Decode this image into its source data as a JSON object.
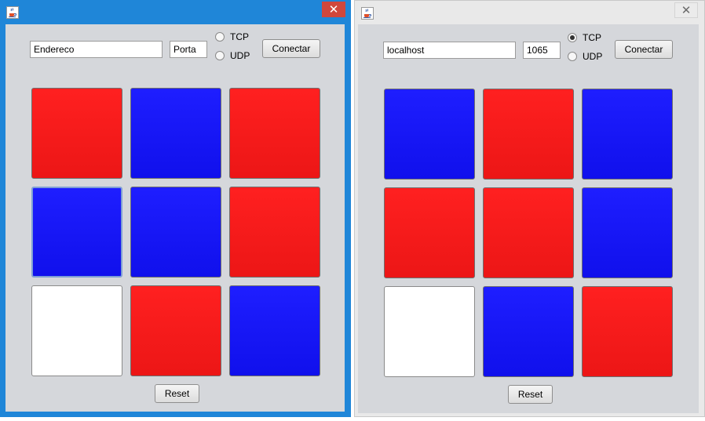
{
  "windows": [
    {
      "id": "left",
      "address_value": "Endereco",
      "port_value": "Porta",
      "protocols": [
        {
          "label": "TCP",
          "selected": false
        },
        {
          "label": "UDP",
          "selected": false
        }
      ],
      "connect_label": "Conectar",
      "reset_label": "Reset",
      "close_glyph": "✕",
      "cells": [
        "red",
        "blue",
        "red",
        "blue",
        "blue",
        "red",
        "white",
        "red",
        "blue"
      ],
      "focused_cell": 3
    },
    {
      "id": "right",
      "address_value": "localhost",
      "port_value": "1065",
      "protocols": [
        {
          "label": "TCP",
          "selected": true
        },
        {
          "label": "UDP",
          "selected": false
        }
      ],
      "connect_label": "Conectar",
      "reset_label": "Reset",
      "close_glyph": "✕",
      "cells": [
        "blue",
        "red",
        "blue",
        "red",
        "red",
        "blue",
        "white",
        "blue",
        "red"
      ],
      "focused_cell": null
    }
  ],
  "colors": {
    "red": "#ff1c1c",
    "blue": "#1818f6",
    "white": "#ffffff",
    "panel": "#d5d7db",
    "active_frame": "#1f86d8",
    "close_active": "#d0473c"
  },
  "icons": {
    "app": "java-cup-icon",
    "close": "close-icon"
  }
}
